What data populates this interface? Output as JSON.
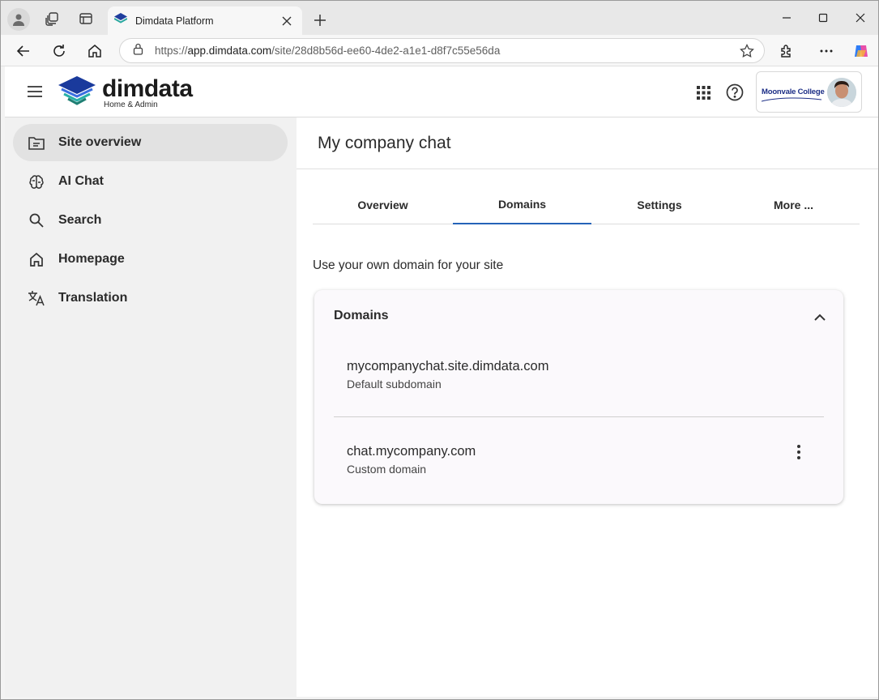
{
  "browser": {
    "tab_title": "Dimdata Platform",
    "url_prefix": "https://",
    "url_host": "app.dimdata.com",
    "url_path": "/site/28d8b56d-ee60-4de2-a1e1-d8f7c55e56da"
  },
  "header": {
    "logo_name": "dimdata",
    "logo_subtitle": "Home & Admin",
    "org_name": "Moonvale College"
  },
  "sidebar": {
    "items": [
      {
        "label": "Site overview",
        "icon": "folder-icon"
      },
      {
        "label": "AI Chat",
        "icon": "brain-icon"
      },
      {
        "label": "Search",
        "icon": "search-icon"
      },
      {
        "label": "Homepage",
        "icon": "home-icon"
      },
      {
        "label": "Translation",
        "icon": "translate-icon"
      }
    ]
  },
  "main": {
    "title": "My company chat",
    "tabs": [
      {
        "label": "Overview"
      },
      {
        "label": "Domains"
      },
      {
        "label": "Settings"
      },
      {
        "label": "More ..."
      }
    ],
    "intro": "Use your own domain for your site",
    "card": {
      "title": "Domains",
      "domains": [
        {
          "name": "mycompanychat.site.dimdata.com",
          "type": "Default subdomain"
        },
        {
          "name": "chat.mycompany.com",
          "type": "Custom domain"
        }
      ]
    }
  },
  "colors": {
    "accent": "#2563b8",
    "sidebar_bg": "#f1f1f1",
    "active_item_bg": "#e2e2e2"
  }
}
